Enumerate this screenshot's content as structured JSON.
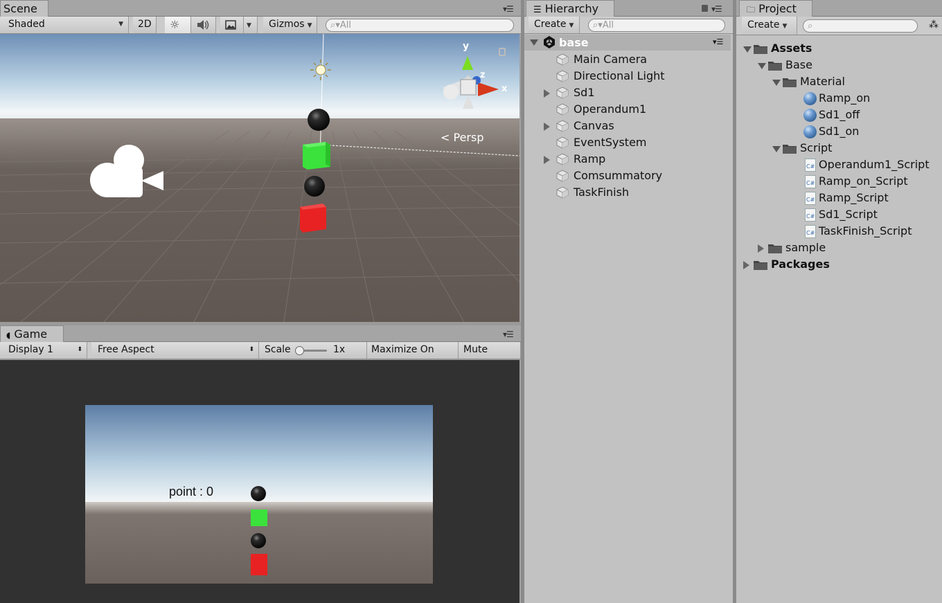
{
  "scene": {
    "tab_label": "Scene",
    "shading_mode": "Shaded",
    "btn_2d": "2D",
    "gizmos_label": "Gizmos",
    "search_placeholder": "All",
    "persp_label": "Persp",
    "axis_y": "y",
    "axis_z": "z",
    "axis_x": "x"
  },
  "game": {
    "tab_label": "Game",
    "display": "Display 1",
    "aspect": "Free Aspect",
    "scale_label": "Scale",
    "scale_value": "1x",
    "maximize_label": "Maximize On Play",
    "mute_label": "Mute Audio",
    "point_text": "point : 0"
  },
  "hierarchy": {
    "tab_label": "Hierarchy",
    "create_label": "Create",
    "search_placeholder": "All",
    "scene_name": "base",
    "items": [
      {
        "label": "Main Camera",
        "expandable": false
      },
      {
        "label": "Directional Light",
        "expandable": false
      },
      {
        "label": "Sd1",
        "expandable": true
      },
      {
        "label": "Operandum1",
        "expandable": false
      },
      {
        "label": "Canvas",
        "expandable": true
      },
      {
        "label": "EventSystem",
        "expandable": false
      },
      {
        "label": "Ramp",
        "expandable": true
      },
      {
        "label": "Comsummatory",
        "expandable": false
      },
      {
        "label": "TaskFinish",
        "expandable": false
      }
    ]
  },
  "project": {
    "tab_label": "Project",
    "create_label": "Create",
    "tree": {
      "assets": "Assets",
      "base": "Base",
      "material": "Material",
      "materials": [
        "Ramp_on",
        "Sd1_off",
        "Sd1_on"
      ],
      "script": "Script",
      "scripts": [
        "Operandum1_Script",
        "Ramp_on_Script",
        "Ramp_Script",
        "Sd1_Script",
        "TaskFinish_Script"
      ],
      "sample": "sample",
      "packages": "Packages"
    },
    "cs_badge": "C#"
  },
  "colors": {
    "green_cube": "#3be23b",
    "red_cube": "#e82222",
    "panel_bg": "#c2c2c2",
    "game_bg": "#313131"
  }
}
